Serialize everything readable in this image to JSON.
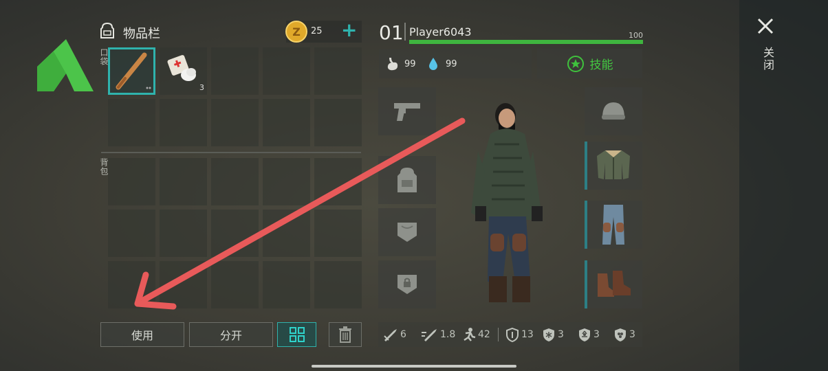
{
  "inventory": {
    "title": "物品栏",
    "pocket_label": "口袋",
    "backpack_label": "背包",
    "medkit_count": "3"
  },
  "currency": {
    "amount": "25",
    "add_symbol": "+"
  },
  "player": {
    "level": "01",
    "name": "Player6043",
    "health": "100",
    "health_fraction": 1.0
  },
  "vitals": {
    "hunger": "99",
    "thirst": "99"
  },
  "skills_label": "技能",
  "buttons": {
    "use": "使用",
    "split": "分开"
  },
  "close_label": "关闭",
  "stats": {
    "damage": "6",
    "attack_speed": "1.8",
    "move_speed": "42",
    "defense": "13",
    "cold_res": "3",
    "rad_res": "3",
    "toxic_res": "3"
  },
  "colors": {
    "accent_teal": "#2fb3ad",
    "health_green": "#3fb53f",
    "annotation_arrow": "#e85a5a",
    "logo_green": "#4cc44a"
  }
}
